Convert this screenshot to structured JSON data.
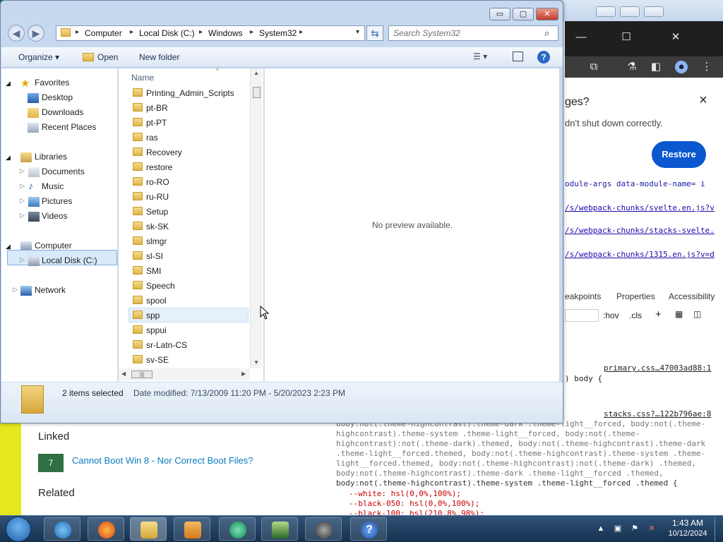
{
  "browser": {
    "restore_question": "ges?",
    "restore_message": "dn't shut down correctly.",
    "restore_button": "Restore",
    "source_links": [
      "odule-args data-module-name= i",
      "/s/webpack-chunks/svelte.en.js?v",
      "/s/webpack-chunks/stacks-svelte.",
      "/s/webpack-chunks/1315.en.js?v=d"
    ],
    "devtools_tabs": [
      "eakpoints",
      "Properties",
      "Accessibility"
    ],
    "devtools_filter_hov": ":hov",
    "devtools_filter_cls": ".cls",
    "css_files": [
      "primary.css…47003ad88:1",
      "stacks.css?…122b796ae:8"
    ],
    "css_rules": [
      ") body {",
      "body:not(.theme-highcontrast).theme-dark .theme-light__forced, body:not(.theme-",
      "highcontrast).theme-system .theme-light__forced, body:not(.theme-",
      "highcontrast):not(.theme-dark).themed, body:not(.theme-highcontrast).theme-dark",
      ".theme-light__forced.themed, body:not(.theme-highcontrast).theme-system .theme-",
      "light__forced.themed, body:not(.theme-highcontrast):not(.theme-dark) .themed,",
      "body:not(.theme-highcontrast).theme-dark .theme-light__forced .themed,",
      "body:not(.theme-highcontrast).theme-system .theme-light__forced .themed {",
      "--white: hsl(0,0%,100%);",
      "--black-050: hsl(0,0%,100%);",
      "--black-100: hsl(210,8%,98%);"
    ]
  },
  "stackoverflow": {
    "linked_heading": "Linked",
    "linked_score": "7",
    "linked_link": "Cannot Boot Win 8 - Nor Correct Boot Files?",
    "related_heading": "Related"
  },
  "explorer": {
    "window_buttons": {
      "minimize": "▭",
      "maximize": "▢",
      "close": "✕"
    },
    "breadcrumbs": [
      "Computer",
      "Local Disk (C:)",
      "Windows",
      "System32"
    ],
    "search_placeholder": "Search System32",
    "commands": {
      "organize": "Organize ▾",
      "open": "Open",
      "new_folder": "New folder"
    },
    "nav": {
      "favorites": "Favorites",
      "desktop": "Desktop",
      "downloads": "Downloads",
      "recent_places": "Recent Places",
      "libraries": "Libraries",
      "documents": "Documents",
      "music": "Music",
      "pictures": "Pictures",
      "videos": "Videos",
      "computer": "Computer",
      "local_disk": "Local Disk (C:)",
      "network": "Network"
    },
    "list_header": "Name",
    "folders": [
      "Printing_Admin_Scripts",
      "pt-BR",
      "pt-PT",
      "ras",
      "Recovery",
      "restore",
      "ro-RO",
      "ru-RU",
      "Setup",
      "sk-SK",
      "slmgr",
      "sl-SI",
      "SMI",
      "Speech",
      "spool",
      "spp",
      "sppui",
      "sr-Latn-CS",
      "sv-SE"
    ],
    "hover_folder": "spp",
    "preview_text": "No preview available.",
    "details": {
      "selected": "2 items selected",
      "date_modified": "Date modified: 7/13/2009 11:20 PM - 5/20/2023 2:23 PM"
    }
  },
  "taskbar": {
    "apps": [
      "internet-explorer",
      "firefox",
      "file-explorer",
      "media-player",
      "app-green",
      "app-checklist",
      "app-headphones",
      "help"
    ],
    "time": "1:43 AM",
    "date": "10/12/2024"
  },
  "colors": {
    "accent": "#2b68c4",
    "restore_button": "#0b57d0",
    "taskbar": "#1f3f63"
  }
}
